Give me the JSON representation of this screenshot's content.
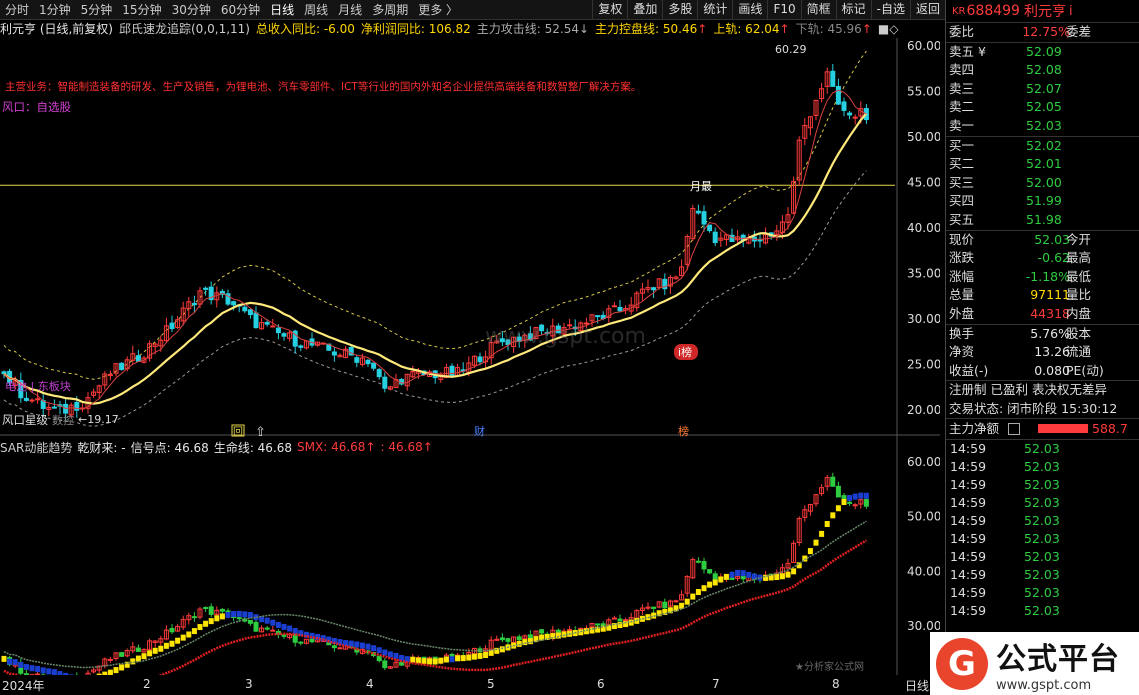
{
  "toolbar": {
    "periods": [
      "分时",
      "1分钟",
      "5分钟",
      "15分钟",
      "30分钟",
      "60分钟",
      "日线",
      "周线",
      "月线",
      "多周期",
      "更多 〉"
    ],
    "active_period": "日线",
    "right_buttons": [
      "复权",
      "叠加",
      "多股",
      "统计",
      "画线",
      "F10",
      "简框",
      "标记",
      "-自选",
      "返回"
    ]
  },
  "infobar": {
    "stock_title": "利元亨 (日线,前复权)",
    "indicator": "邱氏速龙追踪(0,0,1,11)",
    "revenue_yoy": "总收入同比: -6.00",
    "profit_yoy": "净利润同比: 106.82",
    "attack_line": "主力攻击线: 52.54",
    "attack_arrow": "↓",
    "control_line": "主力控盘线: 50.46",
    "control_arrow": "↑",
    "upper_rail": "上轨: 62.04",
    "upper_arrow": "↑",
    "lower_rail": "下轨: 45.96",
    "lower_arrow": "↑",
    "tail": "■◇"
  },
  "annotations": {
    "business": "主营业务：智能制造装备的研发、生产及销售，为锂电池、汽车零部件、ICT等行业的国内外知名企业提供高端装备和数智整厂解决方案。",
    "fengkou": "风口：自选股",
    "high_label": "60.29",
    "low_label": "←19.17",
    "month_tag": "月最",
    "dragon_tag_main": "i榜",
    "fengkou_rank": "风口星级",
    "event_hui": "回",
    "event_cai": "财",
    "event_bang": "榜",
    "watermark": "www.gspt.com",
    "purple_text": "电池 | 东板块",
    "purple_text2": "数控",
    "watermark2": "★分析家公式网"
  },
  "upper_axis": [
    "60.00",
    "55.00",
    "50.00",
    "45.00",
    "40.00",
    "35.00",
    "30.00",
    "25.00",
    "20.00"
  ],
  "lower_axis": [
    "60.00",
    "50.00",
    "40.00",
    "30.00"
  ],
  "lowerbar": {
    "name": "SAR动能趋势",
    "qiancai": "乾财来: -",
    "signal": "信号点: 46.68",
    "lifeline": "生命线: 46.68",
    "smx": "SMX: 46.68",
    "smx_arrow": "↑",
    "extra": ": 46.68",
    "extra_arrow": "↑"
  },
  "xaxis": {
    "labels": [
      "2024年",
      "2",
      "3",
      "4",
      "5",
      "6",
      "7",
      "8"
    ],
    "right": "日线"
  },
  "quote": {
    "code": "688499",
    "name": "利元亨",
    "market": "KR",
    "info_icon": "i",
    "weibi_label": "委比",
    "weibi": "12.75%",
    "weicha_label": "委差",
    "asks": [
      {
        "label": "卖五 ¥",
        "price": "52.09"
      },
      {
        "label": "卖四",
        "price": "52.08"
      },
      {
        "label": "卖三",
        "price": "52.07"
      },
      {
        "label": "卖二",
        "price": "52.05"
      },
      {
        "label": "卖一",
        "price": "52.03"
      }
    ],
    "bids": [
      {
        "label": "买一",
        "price": "52.02"
      },
      {
        "label": "买二",
        "price": "52.01"
      },
      {
        "label": "买三",
        "price": "52.00"
      },
      {
        "label": "买四",
        "price": "51.99"
      },
      {
        "label": "买五",
        "price": "51.98"
      }
    ],
    "stats": [
      {
        "l": "现价",
        "v": "52.03",
        "l2": "今开",
        "vc": "green"
      },
      {
        "l": "涨跌",
        "v": "-0.62",
        "l2": "最高",
        "vc": "green"
      },
      {
        "l": "涨幅",
        "v": "-1.18%",
        "l2": "最低",
        "vc": "green"
      },
      {
        "l": "总量",
        "v": "97111",
        "l2": "量比",
        "vc": "yellow"
      },
      {
        "l": "外盘",
        "v": "44318",
        "l2": "内盘",
        "vc": "red"
      }
    ],
    "stats2": [
      {
        "l": "换手",
        "v": "5.76%",
        "l2": "股本"
      },
      {
        "l": "净资",
        "v": "13.26",
        "l2": "流通"
      },
      {
        "l": "收益(-)",
        "v": "0.080",
        "l2": "PE(动)"
      }
    ],
    "reg": "注册制 已盈利 表决权无差异",
    "trade_status": "交易状态: 闭市阶段 15:30:12",
    "main_net_label": "主力净额",
    "main_net_value": "588.7",
    "ticks": [
      {
        "t": "14:59",
        "p": "52.03"
      },
      {
        "t": "14:59",
        "p": "52.03"
      },
      {
        "t": "14:59",
        "p": "52.03"
      },
      {
        "t": "14:59",
        "p": "52.03"
      },
      {
        "t": "14:59",
        "p": "52.03"
      },
      {
        "t": "14:59",
        "p": "52.03"
      },
      {
        "t": "14:59",
        "p": "52.03"
      },
      {
        "t": "14:59",
        "p": "52.03"
      },
      {
        "t": "14:59",
        "p": "52.03"
      },
      {
        "t": "14:59",
        "p": "52.03"
      }
    ]
  },
  "logo": {
    "mark": "G",
    "title": "公式平台",
    "url": "www.gspt.com"
  },
  "colors": {
    "up": "#ff3b3b",
    "down": "#2ecc40",
    "ma": "#ffe97a",
    "rail": "#d6c84a",
    "lower_rail": "#9a9a9a"
  }
}
